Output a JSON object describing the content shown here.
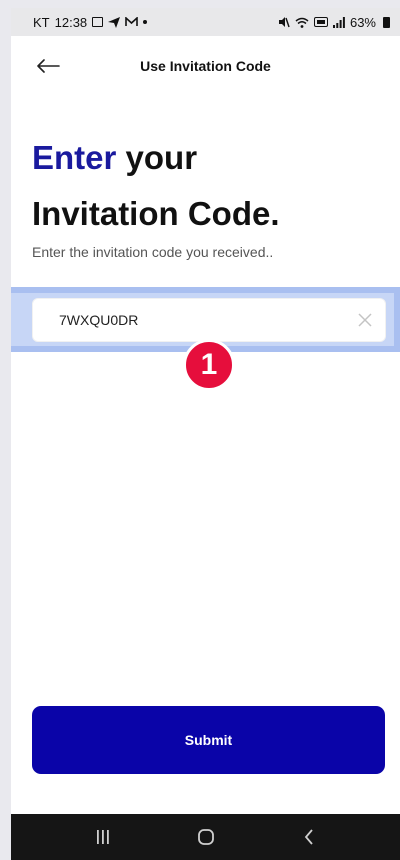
{
  "status_bar": {
    "carrier": "KT",
    "time": "12:38",
    "battery": "63%"
  },
  "header": {
    "title": "Use Invitation Code"
  },
  "headline": {
    "accent": "Enter",
    "rest_line1": " your",
    "line2": "Invitation Code."
  },
  "subtitle": "Enter the invitation code you received..",
  "code_input": {
    "value": "7WXQU0DR"
  },
  "step_badge": "1",
  "submit_label": "Submit",
  "icons": {
    "back": "arrow-left-icon",
    "clear": "close-icon",
    "nav_recent": "recent-apps-icon",
    "nav_home": "home-icon",
    "nav_back": "chevron-left-icon"
  },
  "colors": {
    "accent": "#1a1a9e",
    "button": "#0a04a8",
    "highlight": "#a9bff0",
    "badge": "#e60e3c"
  }
}
